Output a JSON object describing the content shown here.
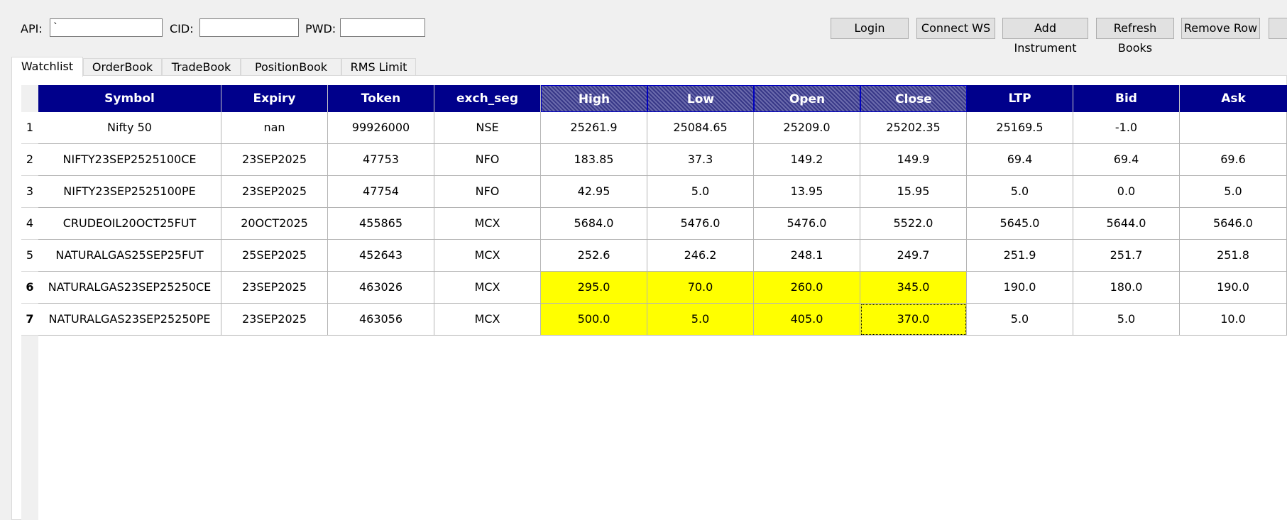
{
  "toolbar": {
    "api_label": "API:",
    "api_value": "`",
    "cid_label": "CID:",
    "cid_value": "",
    "pwd_label": "PWD:",
    "pwd_value": "",
    "buttons": [
      "Login",
      "Connect WS",
      "Add Instrument",
      "Refresh Books",
      "Remove Row"
    ]
  },
  "tabs": [
    "Watchlist",
    "OrderBook",
    "TradeBook",
    "PositionBook",
    "RMS Limit"
  ],
  "active_tab": "Watchlist",
  "table": {
    "columns": [
      "Symbol",
      "Expiry",
      "Token",
      "exch_seg",
      "High",
      "Low",
      "Open",
      "Close",
      "LTP",
      "Bid",
      "Ask"
    ],
    "selected_columns": [
      "High",
      "Low",
      "Open",
      "Close"
    ],
    "row_numbers": [
      "1",
      "2",
      "3",
      "4",
      "5",
      "6",
      "7"
    ],
    "rows": [
      [
        "Nifty 50",
        "nan",
        "99926000",
        "NSE",
        "25261.9",
        "25084.65",
        "25209.0",
        "25202.35",
        "25169.5",
        "-1.0",
        ""
      ],
      [
        "NIFTY23SEP2525100CE",
        "23SEP2025",
        "47753",
        "NFO",
        "183.85",
        "37.3",
        "149.2",
        "149.9",
        "69.4",
        "69.4",
        "69.6"
      ],
      [
        "NIFTY23SEP2525100PE",
        "23SEP2025",
        "47754",
        "NFO",
        "42.95",
        "5.0",
        "13.95",
        "15.95",
        "5.0",
        "0.0",
        "5.0"
      ],
      [
        "CRUDEOIL20OCT25FUT",
        "20OCT2025",
        "455865",
        "MCX",
        "5684.0",
        "5476.0",
        "5476.0",
        "5522.0",
        "5645.0",
        "5644.0",
        "5646.0"
      ],
      [
        "NATURALGAS25SEP25FUT",
        "25SEP2025",
        "452643",
        "MCX",
        "252.6",
        "246.2",
        "248.1",
        "249.7",
        "251.9",
        "251.7",
        "251.8"
      ],
      [
        "NATURALGAS23SEP25250CE",
        "23SEP2025",
        "463026",
        "MCX",
        "295.0",
        "70.0",
        "260.0",
        "345.0",
        "190.0",
        "180.0",
        "190.0"
      ],
      [
        "NATURALGAS23SEP25250PE",
        "23SEP2025",
        "463056",
        "MCX",
        "500.0",
        "5.0",
        "405.0",
        "370.0",
        "5.0",
        "5.0",
        "10.0"
      ]
    ],
    "highlight_color": "#ffff00",
    "header_color": "#00008b"
  }
}
